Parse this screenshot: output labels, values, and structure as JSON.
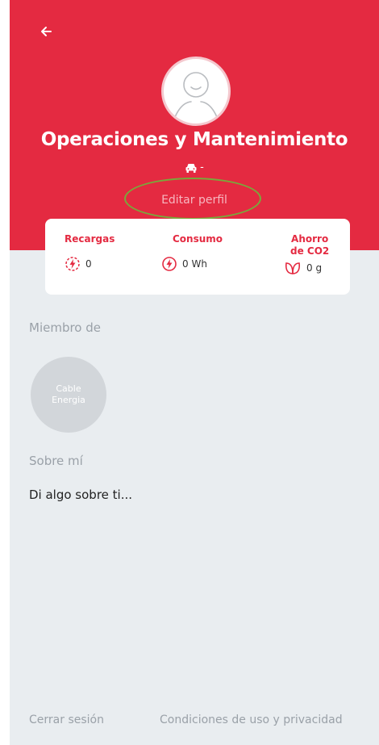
{
  "profile": {
    "name": "Operaciones y Mantenimiento",
    "car_text": "-",
    "edit_label": "Editar perfil"
  },
  "stats": {
    "recharges": {
      "label_line1": "Recargas",
      "value": "0"
    },
    "consumption": {
      "label_line1": "Consumo",
      "value": "0 Wh"
    },
    "co2": {
      "label_line1": "Ahorro",
      "label_line2": "de CO2",
      "value": "0 g"
    }
  },
  "member": {
    "title": "Miembro de",
    "group_line1": "Cable",
    "group_line2": "Energia"
  },
  "about": {
    "title": "Sobre mí",
    "text": "Di algo sobre ti..."
  },
  "footer": {
    "logout": "Cerrar sesión",
    "terms": "Condiciones de uso y privacidad"
  },
  "icons": {
    "back": "arrow-left-icon",
    "avatar": "user-face-icon",
    "car": "car-icon",
    "recharges": "charge-cycle-icon",
    "consumption": "lightning-icon",
    "co2": "leaf-icon"
  },
  "colors": {
    "brand": "#e42a41",
    "background": "#e9edf0",
    "highlight": "#7aa83b"
  }
}
